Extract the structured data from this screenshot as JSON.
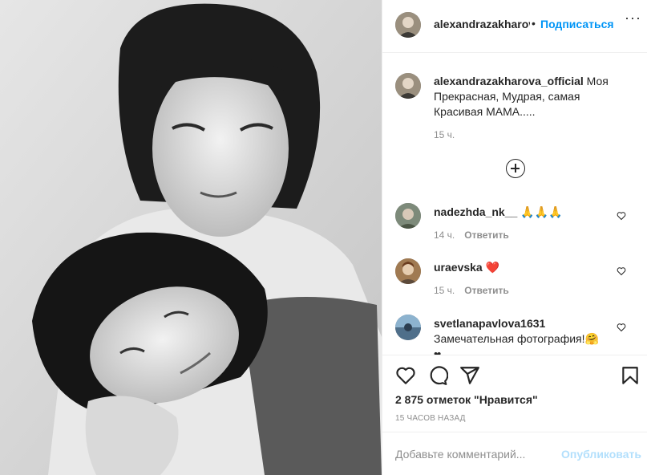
{
  "post": {
    "photo_icon": "black-and-white-photo-mother-and-child",
    "author": {
      "username": "alexandrazakharov",
      "follow_label": "Подписаться",
      "separator": "•"
    },
    "caption": {
      "username": "alexandrazakharova_official",
      "text": " Моя Прекрасная, Мудрая, самая Красивая МАМА.....",
      "time": "15 ч."
    },
    "load_more_icon": "plus-circle-icon",
    "comments": [
      {
        "username": "nadezhda_nk__",
        "text": " 🙏🙏🙏",
        "time": "14 ч.",
        "reply_label": "Ответить"
      },
      {
        "username": "uraevska",
        "text": " ❤️",
        "time": "15 ч.",
        "reply_label": "Ответить"
      },
      {
        "username": "svetlanapavlova1631",
        "text": " Замечательная фотография!🤗",
        "extra": "❤",
        "time": "",
        "reply_label": ""
      }
    ],
    "actions": {
      "icons": [
        "heart-icon",
        "comment-icon",
        "share-icon",
        "bookmark-icon"
      ]
    },
    "likes_text": "2 875 отметок \"Нравится\"",
    "posted_time": "15 часов назад",
    "comment_box": {
      "placeholder": "Добавьте комментарий...",
      "publish_label": "Опубликовать"
    }
  },
  "colors": {
    "accent": "#0095f6",
    "publish_disabled": "#b2dffc",
    "secondary_text": "#8e8e8e",
    "heart_red": "#ed4956"
  }
}
